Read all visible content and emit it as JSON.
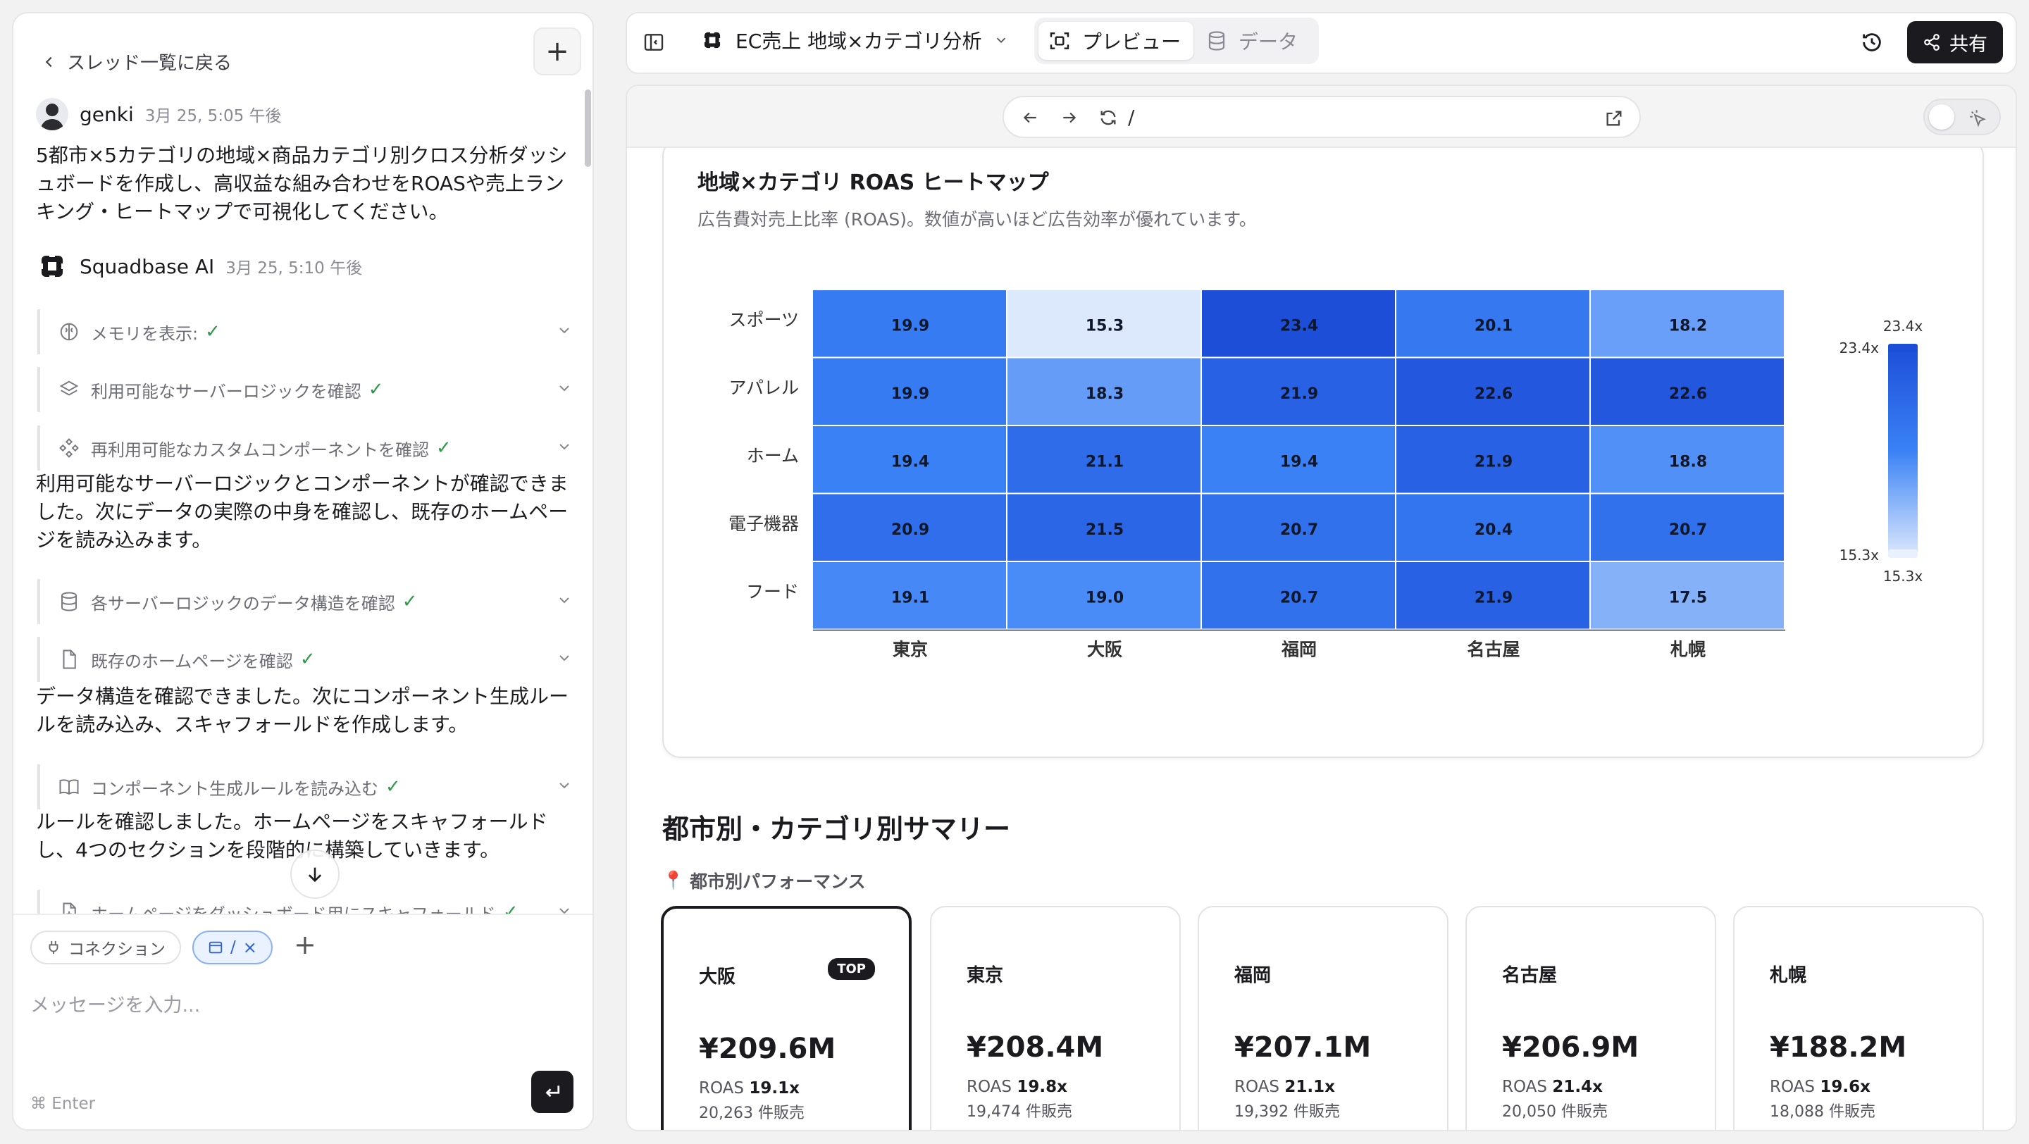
{
  "thread": {
    "back_label": "スレッド一覧に戻る",
    "messages": [
      {
        "author": "genki",
        "time": "3月 25, 5:05 午後",
        "text_lines": [
          "5都市×5カテゴリの地域×商品カテゴリ別クロス分析ダッシ",
          "ュボードを作成し、高収益な組み合わせをROASや売上ラン",
          "キング・ヒートマップで可視化してください。"
        ]
      },
      {
        "author": "Squadbase AI",
        "time": "3月 25, 5:10 午後"
      }
    ],
    "steps": [
      {
        "label": "メモリを表示:",
        "icon": "brain-icon"
      },
      {
        "label": "利用可能なサーバーロジックを確認",
        "icon": "layers-icon"
      },
      {
        "label": "再利用可能なカスタムコンポーネントを確認",
        "icon": "components-icon"
      },
      {
        "label": "各サーバーロジックのデータ構造を確認",
        "icon": "database-icon"
      },
      {
        "label": "既存のホームページを確認",
        "icon": "file-icon"
      },
      {
        "label": "コンポーネント生成ルールを読み込む",
        "icon": "book-icon"
      },
      {
        "label": "ホームページをダッシュボード用にスキャフォールド",
        "icon": "file-plus-icon"
      }
    ],
    "ai_paragraphs": [
      [
        "利用可能なサーバーロジックとコンポーネントが確認できま",
        "した。次にデータの実際の中身を確認し、既存のホームペー",
        "ジを読み込みます。"
      ],
      [
        "データ構造を確認できました。次にコンポーネント生成ルー",
        "ルを読み込み、スキャフォールドを作成します。"
      ],
      [
        "ルールを確認しました。ホームページをスキャフォールド",
        "し、4つのセクションを段階的に構築していきます。"
      ]
    ],
    "composer": {
      "chip_connection": "コネクション",
      "chip_page": "/",
      "placeholder": "メッセージを入力...",
      "shortcut_hint": "⌘ Enter"
    }
  },
  "topbar": {
    "project_title": "EC売上 地域×カテゴリ分析",
    "tab_preview": "プレビュー",
    "tab_data": "データ",
    "share_label": "共有"
  },
  "browser": {
    "url": "/"
  },
  "heatmap": {
    "title": "地域×カテゴリ ROAS ヒートマップ",
    "subtitle": "広告費対売上比率 (ROAS)。数値が高いほど広告効率が優れています。",
    "legend_max": "23.4x",
    "legend_min": "15.3x"
  },
  "chart_data": {
    "type": "heatmap",
    "title": "地域×カテゴリ ROAS ヒートマップ",
    "x": [
      "東京",
      "大阪",
      "福岡",
      "名古屋",
      "札幌"
    ],
    "y": [
      "スポーツ",
      "アパレル",
      "ホーム",
      "電子機器",
      "フード"
    ],
    "values": [
      [
        19.9,
        15.3,
        23.4,
        20.1,
        18.2
      ],
      [
        19.9,
        18.3,
        21.9,
        22.6,
        22.6
      ],
      [
        19.4,
        21.1,
        19.4,
        21.9,
        18.8
      ],
      [
        20.9,
        21.5,
        20.7,
        20.4,
        20.7
      ],
      [
        19.1,
        19.0,
        20.7,
        21.9,
        17.5
      ]
    ],
    "zlim": [
      15.3,
      23.4
    ],
    "colors": {
      "low": "#dce8fc",
      "high": "#1d4ed8"
    }
  },
  "summary": {
    "heading": "都市別・カテゴリ別サマリー",
    "subheading": "都市別パフォーマンス",
    "cities": [
      {
        "name": "大阪",
        "badge": "TOP",
        "revenue": "¥209.6M",
        "roas_label": "ROAS",
        "roas": "19.1x",
        "sold": "20,263 件販売"
      },
      {
        "name": "東京",
        "revenue": "¥208.4M",
        "roas_label": "ROAS",
        "roas": "19.8x",
        "sold": "19,474 件販売"
      },
      {
        "name": "福岡",
        "revenue": "¥207.1M",
        "roas_label": "ROAS",
        "roas": "21.1x",
        "sold": "19,392 件販売"
      },
      {
        "name": "名古屋",
        "revenue": "¥206.9M",
        "roas_label": "ROAS",
        "roas": "21.4x",
        "sold": "20,050 件販売"
      },
      {
        "name": "札幌",
        "revenue": "¥188.2M",
        "roas_label": "ROAS",
        "roas": "19.6x",
        "sold": "18,088 件販売"
      }
    ]
  }
}
